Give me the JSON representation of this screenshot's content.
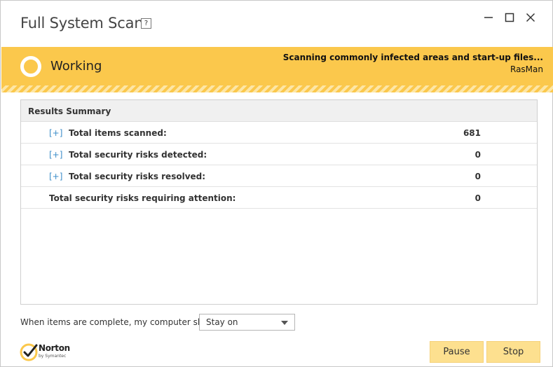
{
  "window": {
    "title": "Full System Scan",
    "help_label": "?"
  },
  "banner": {
    "status": "Working",
    "scan_line": "Scanning commonly infected areas and start-up files...",
    "current_item": "RasMan",
    "color": "#fbc84c"
  },
  "results": {
    "header": "Results Summary",
    "expand_label": "[+]",
    "rows": [
      {
        "label": "Total items scanned:",
        "value": "681",
        "expandable": true
      },
      {
        "label": "Total security risks detected:",
        "value": "0",
        "expandable": true
      },
      {
        "label": "Total security risks resolved:",
        "value": "0",
        "expandable": true
      },
      {
        "label": "Total security risks requiring attention:",
        "value": "0",
        "expandable": false
      }
    ]
  },
  "footer": {
    "after_label": "When items are complete, my computer should",
    "after_select_value": "Stay on",
    "logo_name": "Norton",
    "logo_sub": "by Symantec",
    "pause_label": "Pause",
    "stop_label": "Stop"
  },
  "icons": {
    "minimize": "minimize-icon",
    "maximize": "maximize-icon",
    "close": "close-icon",
    "status": "status-ring-icon",
    "dropdown": "chevron-down-icon",
    "logo": "norton-check-icon"
  }
}
